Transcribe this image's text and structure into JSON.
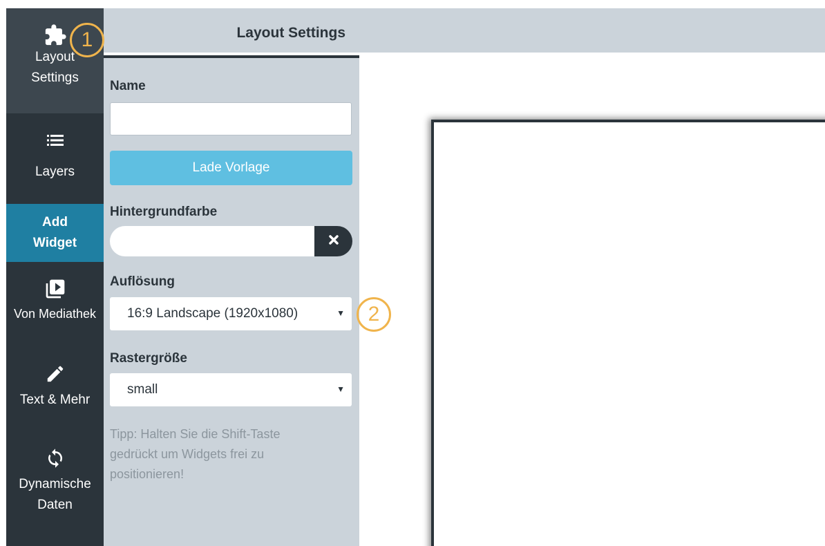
{
  "nav": {
    "items": [
      {
        "icon": "puzzle-icon",
        "label_line1": "Layout",
        "label_line2": "Settings"
      },
      {
        "icon": "list-icon",
        "label": "Layers"
      },
      {
        "label_line1": "Add",
        "label_line2": "Widget"
      },
      {
        "icon": "media-library-icon",
        "label": "Von Mediathek"
      },
      {
        "icon": "pencil-icon",
        "label": "Text & Mehr"
      },
      {
        "icon": "sync-icon",
        "label_line1": "Dynamische",
        "label_line2": "Daten"
      }
    ]
  },
  "panel": {
    "title": "Layout Settings",
    "name_label": "Name",
    "name_value": "",
    "load_template_button": "Lade Vorlage",
    "background_label": "Hintergrundfarbe",
    "background_value": "",
    "resolution_label": "Auflösung",
    "resolution_value": "16:9 Landscape (1920x1080)",
    "grid_label": "Rastergröße",
    "grid_value": "small",
    "tip": "Tipp: Halten Sie die Shift-Taste gedrückt um Widgets frei zu positionieren!"
  },
  "callouts": [
    "1",
    "2"
  ],
  "colors": {
    "nav_bg": "#2b343b",
    "nav_active_bg": "#3d474f",
    "add_widget_bg": "#1f7fa2",
    "panel_bg": "#cbd3da",
    "button_bg": "#5fbfe1",
    "callout": "#f0b44c"
  }
}
